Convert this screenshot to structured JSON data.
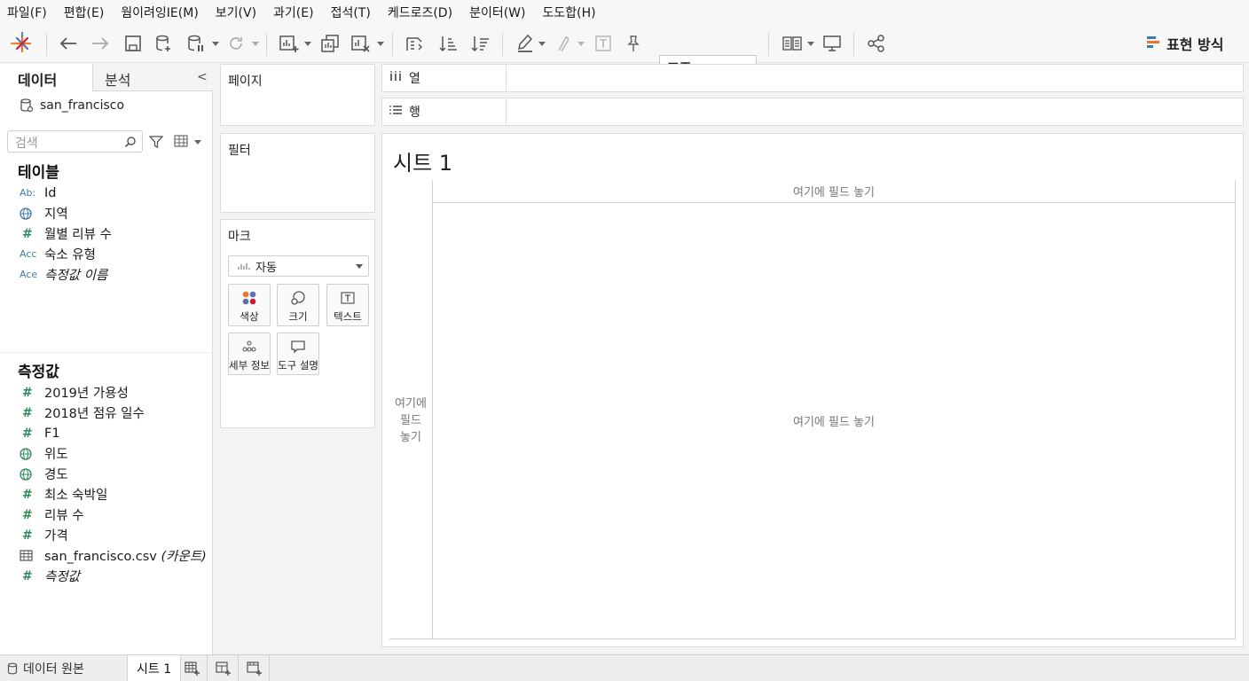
{
  "menu": [
    "파일(F)",
    "편합(E)",
    "웜이려잉IE(M)",
    "보기(V)",
    "과기(E)",
    "접석(T)",
    "케드로즈(D)",
    "분이터(W)",
    "도도합(H)"
  ],
  "toolbar": {
    "fit_value": "표준",
    "show_me": "표현 방식"
  },
  "left": {
    "tab_data": "데이터",
    "tab_analysis": "분석",
    "collapse": "<",
    "datasource": "san_francisco",
    "search_placeholder": "검색",
    "tables_header": "테이블",
    "tables": [
      {
        "icon": "Ab:",
        "label": "Id"
      },
      {
        "icon": "globe",
        "label": "지역"
      },
      {
        "icon": "#",
        "label": "월별 리뷰 수"
      },
      {
        "icon": "Acc",
        "label": "숙소 유형"
      },
      {
        "icon": "Ace",
        "label": "측정값 이름"
      }
    ],
    "measures_header": "측정값",
    "measures": [
      {
        "icon": "#",
        "label": "2019년 가용성"
      },
      {
        "icon": "#",
        "label": "2018년 점유 일수"
      },
      {
        "icon": "#",
        "label": "F1"
      },
      {
        "icon": "globe",
        "label": "위도"
      },
      {
        "icon": "globe",
        "label": "경도"
      },
      {
        "icon": "#",
        "label": "최소 숙박일"
      },
      {
        "icon": "#",
        "label": "리뷰 수"
      },
      {
        "icon": "#",
        "label": "가격"
      },
      {
        "icon": "table",
        "label": "san_francisco.csv",
        "suffix": "(카운트)"
      },
      {
        "icon": "#",
        "label": "측정값"
      }
    ]
  },
  "cards": {
    "pages": "페이지",
    "filters": "필터",
    "marks": "마크",
    "mark_type": "자동",
    "mark_buttons": [
      "색상",
      "크기",
      "텍스트",
      "세부 정보",
      "도구 설명"
    ]
  },
  "shelves": {
    "columns": "열",
    "rows": "행"
  },
  "sheet": {
    "title": "시트 1",
    "drop_top": "여기에 필드 놓기",
    "drop_left": "여기에\n필드\n놓기",
    "drop_main": "여기에 필드 놓기"
  },
  "bottom": {
    "datasource_tab": "데이터 원본",
    "sheet_tab": "시트 1"
  }
}
